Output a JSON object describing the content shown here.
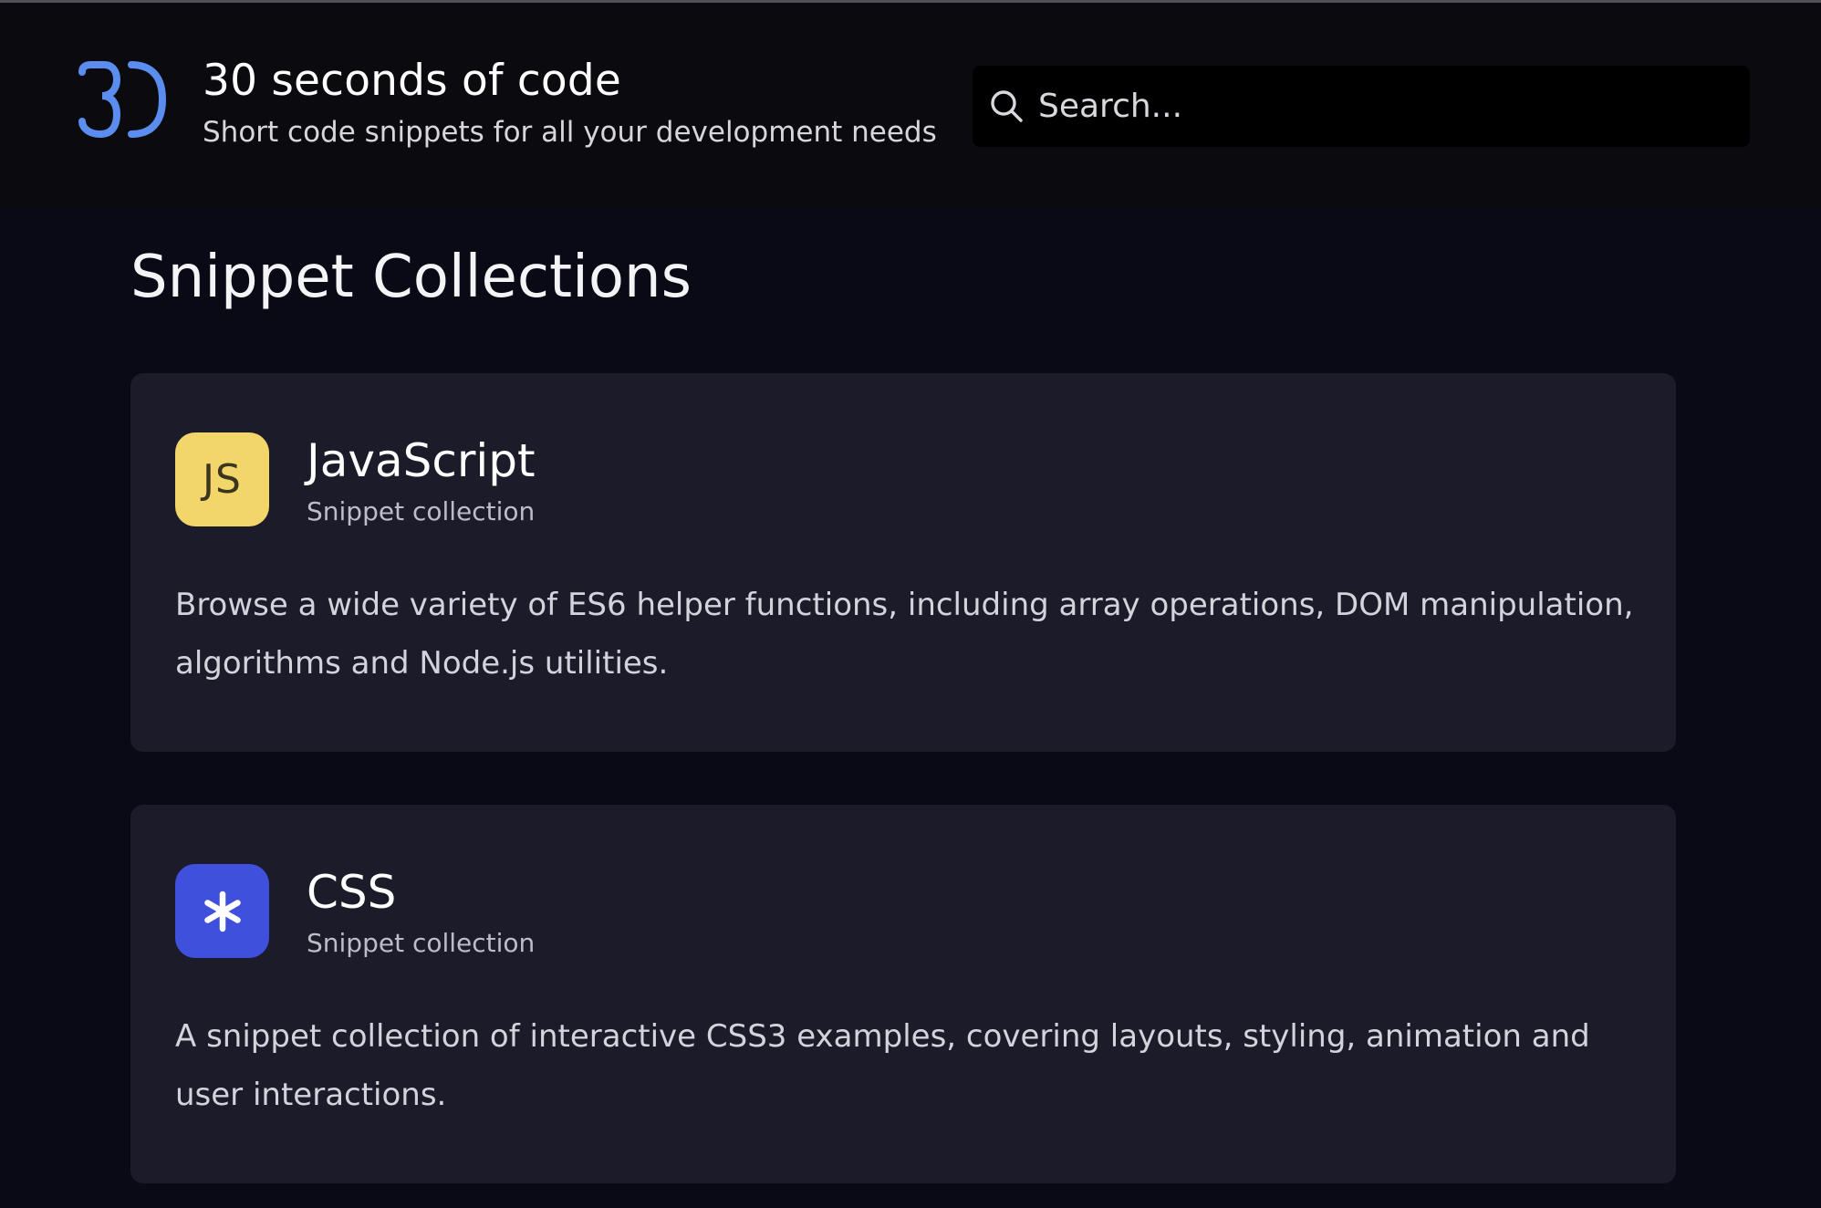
{
  "header": {
    "brand_title": "30 seconds of code",
    "brand_subtitle": "Short code snippets for all your development needs",
    "logo_icon": "30-logo-icon",
    "search": {
      "placeholder": "Search...",
      "icon": "search-icon"
    }
  },
  "main": {
    "title": "Snippet Collections",
    "collections": [
      {
        "name": "JavaScript",
        "kicker": "Snippet collection",
        "icon_text": "JS",
        "icon": "js-icon",
        "icon_color": "#f3d66a",
        "description": "Browse a wide variety of ES6 helper functions, including array operations, DOM manipulation, algorithms and Node.js utilities."
      },
      {
        "name": "CSS",
        "kicker": "Snippet collection",
        "icon": "asterisk-icon",
        "icon_color": "#3f50dc",
        "description": "A snippet collection of interactive CSS3 examples, covering layouts, styling, animation and user interactions."
      }
    ]
  },
  "colors": {
    "page_background": "#0a0a17",
    "header_background": "#0b0b0f",
    "card_background": "#1b1b2a",
    "logo_accent": "#5b8def"
  }
}
